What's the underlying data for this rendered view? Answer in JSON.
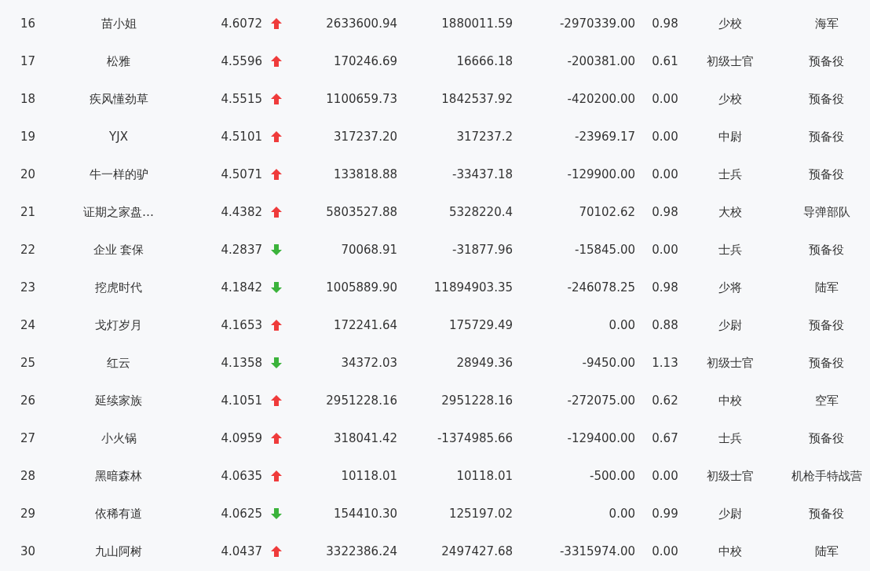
{
  "table": {
    "rows": [
      {
        "rank": "16",
        "name": "苗小姐",
        "score": "4.6072",
        "rising": true,
        "column_4": "2633600.94",
        "column_5": "1880011.59",
        "column_6": "-2970339.00",
        "column_7": "0.98",
        "column_8": "少校",
        "column_9": "海军"
      },
      {
        "rank": "17",
        "name": "松雅",
        "score": "4.5596",
        "rising": true,
        "column_4": "170246.69",
        "column_5": "16666.18",
        "column_6": "-200381.00",
        "column_7": "0.61",
        "column_8": "初级士官",
        "column_9": "预备役"
      },
      {
        "rank": "18",
        "name": "疾风懂劲草",
        "score": "4.5515",
        "rising": true,
        "column_4": "1100659.73",
        "column_5": "1842537.92",
        "column_6": "-420200.00",
        "column_7": "0.00",
        "column_8": "少校",
        "column_9": "预备役"
      },
      {
        "rank": "19",
        "name": "YJX",
        "score": "4.5101",
        "rising": true,
        "column_4": "317237.20",
        "column_5": "317237.2",
        "column_6": "-23969.17",
        "column_7": "0.00",
        "column_8": "中尉",
        "column_9": "预备役"
      },
      {
        "rank": "20",
        "name": "牛一样的驴",
        "score": "4.5071",
        "rising": true,
        "column_4": "133818.88",
        "column_5": "-33437.18",
        "column_6": "-129900.00",
        "column_7": "0.00",
        "column_8": "士兵",
        "column_9": "预备役"
      },
      {
        "rank": "21",
        "name": "证期之家盘…",
        "score": "4.4382",
        "rising": true,
        "column_4": "5803527.88",
        "column_5": "5328220.4",
        "column_6": "70102.62",
        "column_7": "0.98",
        "column_8": "大校",
        "column_9": "导弹部队"
      },
      {
        "rank": "22",
        "name": "企业 套保",
        "score": "4.2837",
        "rising": false,
        "column_4": "70068.91",
        "column_5": "-31877.96",
        "column_6": "-15845.00",
        "column_7": "0.00",
        "column_8": "士兵",
        "column_9": "预备役"
      },
      {
        "rank": "23",
        "name": "挖虎时代",
        "score": "4.1842",
        "rising": false,
        "column_4": "1005889.90",
        "column_5": "11894903.35",
        "column_6": "-246078.25",
        "column_7": "0.98",
        "column_8": "少将",
        "column_9": "陆军"
      },
      {
        "rank": "24",
        "name": "戈灯岁月",
        "score": "4.1653",
        "rising": true,
        "column_4": "172241.64",
        "column_5": "175729.49",
        "column_6": "0.00",
        "column_7": "0.88",
        "column_8": "少尉",
        "column_9": "预备役"
      },
      {
        "rank": "25",
        "name": "红云",
        "score": "4.1358",
        "rising": false,
        "column_4": "34372.03",
        "column_5": "28949.36",
        "column_6": "-9450.00",
        "column_7": "1.13",
        "column_8": "初级士官",
        "column_9": "预备役"
      },
      {
        "rank": "26",
        "name": "延续家族",
        "score": "4.1051",
        "rising": true,
        "column_4": "2951228.16",
        "column_5": "2951228.16",
        "column_6": "-272075.00",
        "column_7": "0.62",
        "column_8": "中校",
        "column_9": "空军"
      },
      {
        "rank": "27",
        "name": "小火锅",
        "score": "4.0959",
        "rising": true,
        "column_4": "318041.42",
        "column_5": "-1374985.66",
        "column_6": "-129400.00",
        "column_7": "0.67",
        "column_8": "士兵",
        "column_9": "预备役"
      },
      {
        "rank": "28",
        "name": "黑暗森林",
        "score": "4.0635",
        "rising": true,
        "column_4": "10118.01",
        "column_5": "10118.01",
        "column_6": "-500.00",
        "column_7": "0.00",
        "column_8": "初级士官",
        "column_9": "机枪手特战营"
      },
      {
        "rank": "29",
        "name": "依稀有道",
        "score": "4.0625",
        "rising": false,
        "column_4": "154410.30",
        "column_5": "125197.02",
        "column_6": "0.00",
        "column_7": "0.99",
        "column_8": "少尉",
        "column_9": "预备役"
      },
      {
        "rank": "30",
        "name": "九山阿树",
        "score": "4.0437",
        "rising": true,
        "column_4": "3322386.24",
        "column_5": "2497427.68",
        "column_6": "-3315974.00",
        "column_7": "0.00",
        "column_8": "中校",
        "column_9": "陆军"
      }
    ]
  }
}
